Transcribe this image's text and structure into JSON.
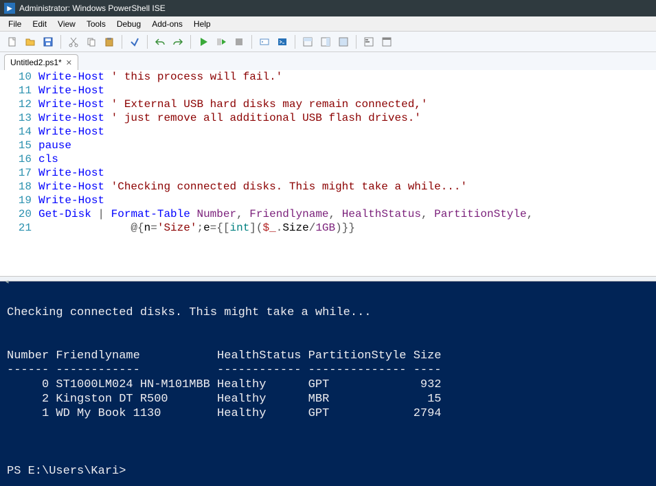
{
  "window": {
    "title": "Administrator: Windows PowerShell ISE"
  },
  "menu": {
    "file": "File",
    "edit": "Edit",
    "view": "View",
    "tools": "Tools",
    "debug": "Debug",
    "addons": "Add-ons",
    "help": "Help"
  },
  "tab": {
    "label": "Untitled2.ps1*"
  },
  "code": {
    "lines": [
      {
        "n": 10,
        "tokens": [
          [
            "k-cmd",
            "Write-Host"
          ],
          [
            "",
            " "
          ],
          [
            "k-str",
            "' this process will fail.'"
          ]
        ]
      },
      {
        "n": 11,
        "tokens": [
          [
            "k-cmd",
            "Write-Host"
          ]
        ]
      },
      {
        "n": 12,
        "tokens": [
          [
            "k-cmd",
            "Write-Host"
          ],
          [
            "",
            " "
          ],
          [
            "k-str",
            "' External USB hard disks may remain connected,'"
          ]
        ]
      },
      {
        "n": 13,
        "tokens": [
          [
            "k-cmd",
            "Write-Host"
          ],
          [
            "",
            " "
          ],
          [
            "k-str",
            "' just remove all additional USB flash drives.'"
          ]
        ]
      },
      {
        "n": 14,
        "tokens": [
          [
            "k-cmd",
            "Write-Host"
          ]
        ]
      },
      {
        "n": 15,
        "tokens": [
          [
            "k-cmd",
            "pause"
          ]
        ]
      },
      {
        "n": 16,
        "tokens": [
          [
            "k-cmd",
            "cls"
          ]
        ]
      },
      {
        "n": 17,
        "tokens": [
          [
            "k-cmd",
            "Write-Host"
          ]
        ]
      },
      {
        "n": 18,
        "tokens": [
          [
            "k-cmd",
            "Write-Host"
          ],
          [
            "",
            " "
          ],
          [
            "k-str",
            "'Checking connected disks. This might take a while...'"
          ]
        ]
      },
      {
        "n": 19,
        "tokens": [
          [
            "k-cmd",
            "Write-Host"
          ]
        ]
      },
      {
        "n": 20,
        "tokens": [
          [
            "k-cmd",
            "Get-Disk"
          ],
          [
            "",
            " "
          ],
          [
            "k-op",
            "|"
          ],
          [
            "",
            " "
          ],
          [
            "k-cmd",
            "Format-Table"
          ],
          [
            "",
            " "
          ],
          [
            "k-param",
            "Number"
          ],
          [
            "k-op",
            ","
          ],
          [
            "",
            " "
          ],
          [
            "k-param",
            "Friendlyname"
          ],
          [
            "k-op",
            ","
          ],
          [
            "",
            " "
          ],
          [
            "k-param",
            "HealthStatus"
          ],
          [
            "k-op",
            ","
          ],
          [
            "",
            " "
          ],
          [
            "k-param",
            "PartitionStyle"
          ],
          [
            "k-op",
            ","
          ]
        ]
      },
      {
        "n": 21,
        "tokens": [
          [
            "",
            "              "
          ],
          [
            "k-op",
            "@{"
          ],
          [
            "",
            "n"
          ],
          [
            "k-op",
            "="
          ],
          [
            "k-str",
            "'Size'"
          ],
          [
            "k-op",
            ";"
          ],
          [
            "",
            "e"
          ],
          [
            "k-op",
            "={"
          ],
          [
            "k-op",
            "["
          ],
          [
            "k-type",
            "int"
          ],
          [
            "k-op",
            "]("
          ],
          [
            "k-var",
            "$_"
          ],
          [
            "k-op",
            "."
          ],
          [
            "",
            "Size"
          ],
          [
            "k-op",
            "/"
          ],
          [
            "k-num",
            "1GB"
          ],
          [
            "k-op",
            ")}}"
          ]
        ]
      }
    ]
  },
  "console": {
    "lines": [
      "",
      "Checking connected disks. This might take a while...",
      "",
      "",
      "Number Friendlyname           HealthStatus PartitionStyle Size",
      "------ ------------           ------------ -------------- ----",
      "     0 ST1000LM024 HN-M101MBB Healthy      GPT             932",
      "     2 Kingston DT R500       Healthy      MBR              15",
      "     1 WD My Book 1130        Healthy      GPT            2794",
      "",
      "",
      "",
      "PS E:\\Users\\Kari> "
    ]
  }
}
